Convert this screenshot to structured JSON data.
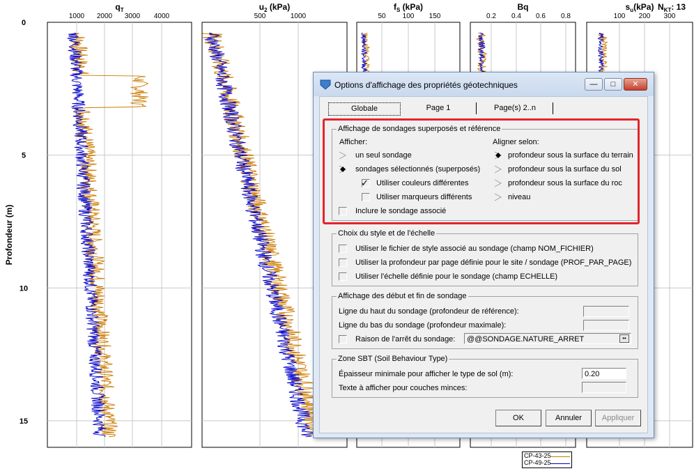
{
  "plot": {
    "y_axis_label": "Profondeur (m)",
    "y_ticks": [
      "0",
      "5",
      "10",
      "15"
    ],
    "panels": [
      {
        "id": "qt",
        "title_main": "q",
        "title_sub": "T",
        "title_unit": "",
        "ticks": [
          "1000",
          "2000",
          "3000",
          "4000"
        ]
      },
      {
        "id": "u2",
        "title_main": "u",
        "title_sub": "2",
        "title_unit": " (kPa)",
        "ticks": [
          "500",
          "1000"
        ]
      },
      {
        "id": "fs",
        "title_main": "f",
        "title_sub": "S",
        "title_unit": " (kPa)",
        "ticks": [
          "50",
          "100",
          "150"
        ]
      },
      {
        "id": "bq",
        "title_main": "Bq",
        "title_sub": "",
        "title_unit": "",
        "ticks": [
          "0.2",
          "0.4",
          "0.6",
          "0.8"
        ]
      },
      {
        "id": "su",
        "title_main": "s",
        "title_sub": "u",
        "title_unit": "(kPa)",
        "ticks": [
          "100",
          "200",
          "300"
        ]
      }
    ],
    "nkt_label_main": "N",
    "nkt_label_sub": "KT",
    "nkt_label_value": ": 13",
    "legend": [
      {
        "name": "CP-43-25",
        "color": "#cc7a00"
      },
      {
        "name": "CP-49-25",
        "color": "#0000cc"
      }
    ]
  },
  "dialog": {
    "title": "Options d'affichage des propriétés géotechniques",
    "tabs": [
      "Globale",
      "Page 1",
      "Page(s) 2..n"
    ],
    "group_superpose": {
      "legend": "Affichage de sondages superposés et référence",
      "afficher_label": "Afficher:",
      "opt_un_seul": "un seul sondage",
      "opt_selectionnes": "sondages sélectionnés (superposés)",
      "chk_couleurs": "Utiliser couleurs différentes",
      "chk_marqueurs": "Utiliser marqueurs différents",
      "chk_inclure": "Inclure le sondage associé",
      "aligner_label": "Aligner selon:",
      "align_terrain": "profondeur sous la surface du terrain",
      "align_sol": "profondeur sous la surface du sol",
      "align_roc": "profondeur sous la surface du roc",
      "align_niveau": "niveau"
    },
    "group_style": {
      "legend": "Choix du style et de l'échelle",
      "chk_fichier": "Utiliser le fichier de style associé au sondage (champ NOM_FICHIER)",
      "chk_profondeur": "Utiliser la profondeur par page définie pour le site / sondage (PROF_PAR_PAGE)",
      "chk_echelle": "Utiliser l'échelle définie pour le sondage (champ ECHELLE)"
    },
    "group_debut": {
      "legend": "Affichage des début et fin de sondage",
      "ligne_haut": "Ligne du haut du sondage (profondeur de référence):",
      "ligne_bas": "Ligne du bas du sondage (profondeur maximale):",
      "chk_raison": "Raison de l'arrêt du sondage:",
      "raison_value": "@@SONDAGE.NATURE_ARRET"
    },
    "group_sbt": {
      "legend": "Zone SBT (Soil Behaviour Type)",
      "epaisseur_label": "Épaisseur minimale pour afficher le type de sol (m):",
      "epaisseur_value": "0.20",
      "texte_label": "Texte à afficher pour couches minces:"
    },
    "buttons": {
      "ok": "OK",
      "annuler": "Annuler",
      "appliquer": "Appliquer"
    }
  }
}
